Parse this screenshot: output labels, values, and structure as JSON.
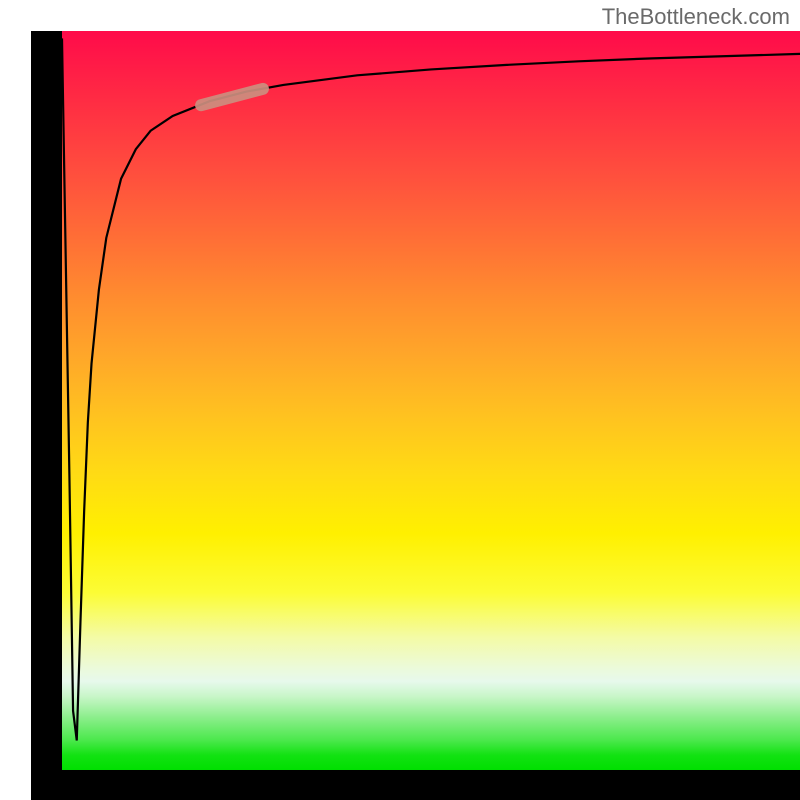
{
  "watermark": "TheBottleneck.com",
  "chart_data": {
    "type": "line",
    "title": "",
    "xlabel": "",
    "ylabel": "",
    "ylim": [
      0,
      100
    ],
    "xlim": [
      0,
      100
    ],
    "series": [
      {
        "name": "curve",
        "description": "V-shaped curve dropping sharply from top-left to bottom then rising logarithmically to top-right",
        "x": [
          0,
          1,
          1.5,
          2,
          2.5,
          3,
          3.5,
          4,
          5,
          6,
          8,
          10,
          12,
          15,
          20,
          25,
          30,
          40,
          50,
          60,
          70,
          80,
          90,
          100
        ],
        "y": [
          99,
          40,
          8,
          4,
          20,
          35,
          47,
          55,
          65,
          72,
          80,
          84,
          86.5,
          88.5,
          90.5,
          91.8,
          92.7,
          94,
          94.8,
          95.4,
          95.9,
          96.3,
          96.6,
          96.9
        ]
      }
    ],
    "background_gradient": {
      "type": "vertical",
      "stops": [
        "#ff0b4a",
        "#ffa729",
        "#fff000",
        "#00df00"
      ],
      "meaning": "red at top (bottleneck) to green at bottom (no bottleneck)"
    },
    "highlight": {
      "x_range": [
        18,
        28
      ],
      "description": "Semi-transparent thick segment highlighting a portion of the rising curve"
    }
  },
  "colors": {
    "frame": "#000000",
    "curve": "#000000",
    "highlight": "#cc8e7f",
    "watermark": "#6a6a6a"
  }
}
